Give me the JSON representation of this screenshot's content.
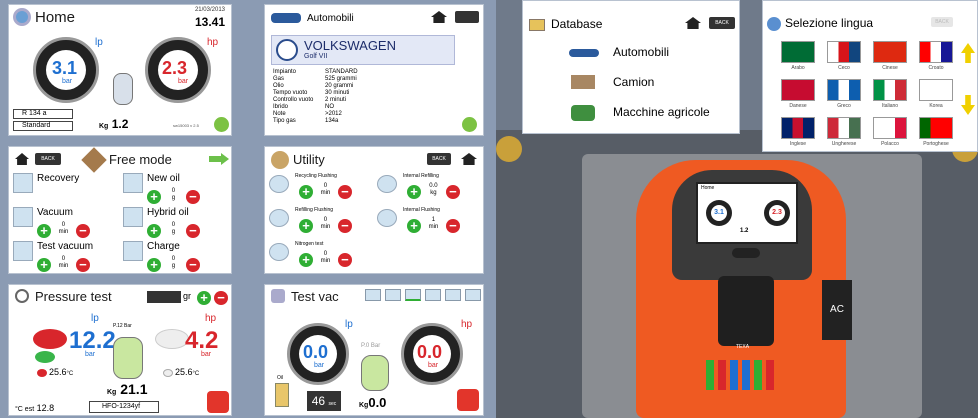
{
  "home": {
    "title": "Home",
    "date": "21/03/2013",
    "time": "13.41",
    "lp_label": "lp",
    "hp_label": "hp",
    "lp_value": "3.1",
    "hp_value": "2.3",
    "unit": "bar",
    "refrigerant": "R 134 a",
    "mode": "Standard",
    "kg_label": "Kg",
    "kg_value": "1.2",
    "version": "sw15003 v 2.5"
  },
  "automobili": {
    "title": "Automobili",
    "brand": "VOLKSWAGEN",
    "model": "Golf VII",
    "specs": [
      [
        "Impianto",
        "STANDARD"
      ],
      [
        "Gas",
        "525 grammi"
      ],
      [
        "Olio",
        "20 grammi"
      ],
      [
        "Tempo vuoto",
        "30 minuti"
      ],
      [
        "Controllo vuoto",
        "2 minuti"
      ],
      [
        "Ibrido",
        "NO"
      ],
      [
        "Note",
        ">2012"
      ],
      [
        "Tipo gas",
        "134a"
      ]
    ]
  },
  "freemode": {
    "title": "Free mode",
    "back": "BACK",
    "items": [
      {
        "label": "Recovery",
        "v1": "",
        "v2": ""
      },
      {
        "label": "New oil",
        "v1": "0",
        "v2": "g"
      },
      {
        "label": "Vacuum",
        "v1": "0",
        "v2": "min"
      },
      {
        "label": "Hybrid oil",
        "v1": "0",
        "v2": "g"
      },
      {
        "label": "Test vacuum",
        "v1": "0",
        "v2": "min"
      },
      {
        "label": "Charge",
        "v1": "0",
        "v2": "g"
      }
    ]
  },
  "utility": {
    "title": "Utility",
    "back": "BACK",
    "items": [
      {
        "label": "Recycling Flushing",
        "v1": "0",
        "v2": "min"
      },
      {
        "label": "Internal Refilling",
        "v1": "0.0",
        "v2": "kg"
      },
      {
        "label": "Refilling Flushing",
        "v1": "0",
        "v2": "min"
      },
      {
        "label": "Internal Flushing",
        "v1": "1",
        "v2": "min"
      },
      {
        "label": "Nitrogen test",
        "v1": "0",
        "v2": "min"
      }
    ]
  },
  "pressure": {
    "title": "Pressure test",
    "gr": "gr",
    "lp_label": "lp",
    "hp_label": "hp",
    "lp_value": "12.2",
    "hp_value": "4.2",
    "unit": "bar",
    "p_label": "P.12 Bar",
    "t1": "25.6",
    "t2": "25.6",
    "tunit": "°C",
    "kg_label": "Kg",
    "kg_value": "21.1",
    "cest": "°C est",
    "cest_value": "12.8",
    "gas": "HFO-1234yf"
  },
  "testvac": {
    "title": "Test vac",
    "lp_label": "lp",
    "hp_label": "hp",
    "lp_value": "0.0",
    "hp_value": "0.0",
    "unit": "bar",
    "p0": "P.0",
    "p0unit": "Bar",
    "oil": "Oil",
    "time": "46",
    "time_unit": "sec",
    "kg_label": "Kg",
    "kg_value": "0.0"
  },
  "database": {
    "title": "Database",
    "back": "BACK",
    "items": [
      "Automobili",
      "Camion",
      "Macchine agricole"
    ]
  },
  "lingua": {
    "title": "Selezione lingua",
    "back": "BACK",
    "flags": [
      {
        "label": "Arabo",
        "c": [
          "#006c35",
          "#006c35",
          "#006c35"
        ]
      },
      {
        "label": "Ceco",
        "c": [
          "#fff",
          "#d7141a",
          "#11457e"
        ]
      },
      {
        "label": "Cinese",
        "c": [
          "#de2910",
          "#de2910",
          "#de2910"
        ]
      },
      {
        "label": "Croato",
        "c": [
          "#ff0000",
          "#fff",
          "#171796"
        ]
      },
      {
        "label": "Danese",
        "c": [
          "#c60c30",
          "#c60c30",
          "#c60c30"
        ]
      },
      {
        "label": "Greco",
        "c": [
          "#0d5eaf",
          "#fff",
          "#0d5eaf"
        ]
      },
      {
        "label": "Italiano",
        "c": [
          "#009246",
          "#fff",
          "#ce2b37"
        ]
      },
      {
        "label": "Korea",
        "c": [
          "#fff",
          "#fff",
          "#fff"
        ]
      },
      {
        "label": "Inglese",
        "c": [
          "#012169",
          "#c8102e",
          "#012169"
        ]
      },
      {
        "label": "Ungherese",
        "c": [
          "#ce2939",
          "#fff",
          "#477050"
        ]
      },
      {
        "label": "Polacco",
        "c": [
          "#fff",
          "#fff",
          "#dc143c"
        ]
      },
      {
        "label": "Portoghese",
        "c": [
          "#006600",
          "#ff0000",
          "#ff0000"
        ]
      }
    ]
  },
  "machine": {
    "screen_title": "Home",
    "screen_lp": "3.1",
    "screen_hp": "2.3",
    "screen_kg": "1.2",
    "brand": "TEXA",
    "label": "AC"
  }
}
